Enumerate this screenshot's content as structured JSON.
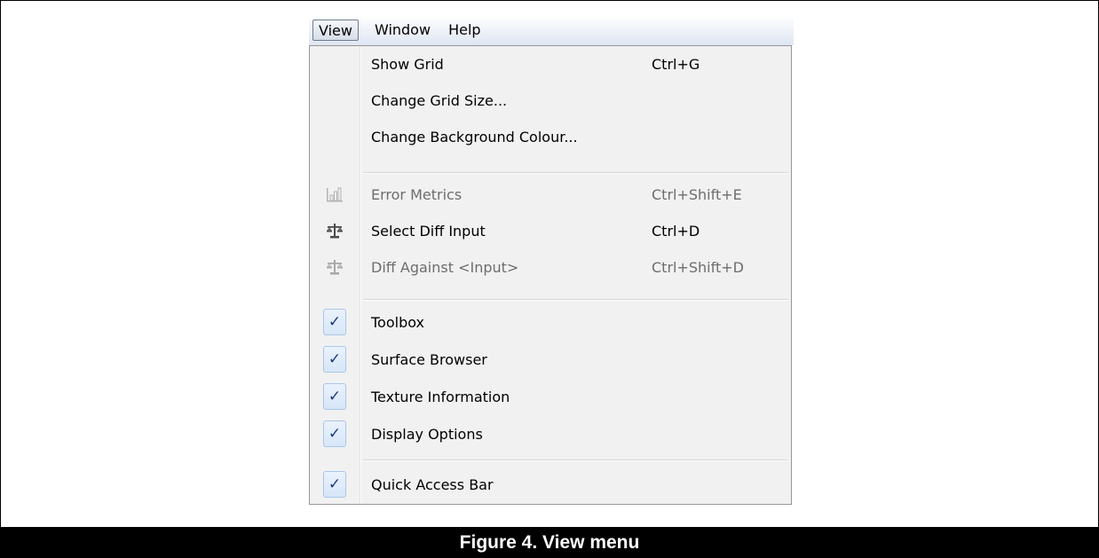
{
  "menubar": {
    "items": [
      {
        "label": "View",
        "open": true
      },
      {
        "label": "Window"
      },
      {
        "label": "Help"
      }
    ]
  },
  "menu": {
    "items": [
      {
        "label": "Show Grid",
        "shortcut": "Ctrl+G",
        "icon": "none",
        "enabled": true
      },
      {
        "label": "Change Grid Size...",
        "shortcut": "",
        "icon": "none",
        "enabled": true
      },
      {
        "label": "Change Background Colour...",
        "shortcut": "",
        "icon": "none",
        "enabled": true
      },
      {
        "label": "Error Metrics",
        "shortcut": "Ctrl+Shift+E",
        "icon": "bar-chart-icon",
        "enabled": false
      },
      {
        "label": "Select Diff Input",
        "shortcut": "Ctrl+D",
        "icon": "scales-icon",
        "enabled": true
      },
      {
        "label": "Diff Against <Input>",
        "shortcut": "Ctrl+Shift+D",
        "icon": "scales-icon",
        "enabled": false
      },
      {
        "label": "Toolbox",
        "shortcut": "",
        "icon": "checkmark-icon",
        "checked": true,
        "enabled": true
      },
      {
        "label": "Surface Browser",
        "shortcut": "",
        "icon": "checkmark-icon",
        "checked": true,
        "enabled": true
      },
      {
        "label": "Texture Information",
        "shortcut": "",
        "icon": "checkmark-icon",
        "checked": true,
        "enabled": true
      },
      {
        "label": "Display Options",
        "shortcut": "",
        "icon": "checkmark-icon",
        "checked": true,
        "enabled": true
      },
      {
        "label": "Quick Access Bar",
        "shortcut": "",
        "icon": "checkmark-icon",
        "checked": true,
        "enabled": true
      }
    ],
    "check_glyph": "✓"
  },
  "caption": "Figure 4. View menu",
  "colors": {
    "menubar_gradient_end": "#dfe6f2",
    "menu_bg": "#f1f1f1",
    "disabled_text": "#6d6d6d",
    "check_color": "#1a3a80"
  }
}
